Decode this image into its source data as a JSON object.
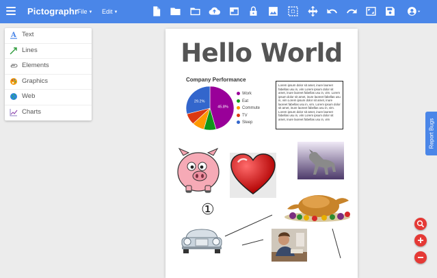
{
  "app": {
    "title": "Pictographr",
    "menus": [
      {
        "label": "File"
      },
      {
        "label": "Edit"
      }
    ],
    "toolbar_icons": [
      "new-document-icon",
      "folder-icon",
      "folder-open-icon",
      "cloud-upload-icon",
      "window-icon",
      "lock-icon",
      "image-icon",
      "select-area-icon",
      "move-icon",
      "undo-icon",
      "redo-icon",
      "fit-screen-icon",
      "save-icon",
      "account-icon"
    ],
    "accent_color": "#4a86e8"
  },
  "sidebar": {
    "items": [
      {
        "label": "Text",
        "icon": "text-icon"
      },
      {
        "label": "Lines",
        "icon": "line-icon"
      },
      {
        "label": "Elements",
        "icon": "paperclip-icon"
      },
      {
        "label": "Graphics",
        "icon": "palette-icon"
      },
      {
        "label": "Web",
        "icon": "globe-icon"
      },
      {
        "label": "Charts",
        "icon": "chart-icon"
      }
    ]
  },
  "canvas": {
    "heading": "Hello World",
    "lorem": "Lorem ipsum dolor sit amet, inure laoreet fabellas usu in, vim Lorem ipsum dolor sit amet, inure laoreet fabellas usu in, vim. Lorem ipsum dolor sit amet, inure laoreet fabellas usu in, vim Lorem ipsum dolor sit amet, inure laoreet fabellas usu in, vim. Lorem ipsum dolor sit amet, inure laoreet fabellas usu in, vim. Lorem ipsum dolor sit amet, inure laoreet fabellas usu in, vim Lorem ipsum dolor sit amet, inure laoreet fabellas usu in, vim",
    "number_badge": "①",
    "graphics": [
      "pig-clipart",
      "heart-clipart",
      "dog-photo",
      "turkey-clipart",
      "car-clipart",
      "person-photo"
    ]
  },
  "chart_data": {
    "type": "pie",
    "title": "Company Performance",
    "categories": [
      "Work",
      "Eat",
      "Commute",
      "TV",
      "Sleep"
    ],
    "values": [
      45.8,
      8.3,
      8.3,
      8.3,
      29.2
    ],
    "data_labels": [
      "45.8%",
      "",
      "",
      "",
      "29.2%"
    ],
    "colors": [
      "#990099",
      "#109618",
      "#ff9900",
      "#dc3912",
      "#3366cc"
    ],
    "legend": "right"
  },
  "report_bugs": {
    "label": "Report Bugs"
  },
  "fabs": [
    {
      "icon": "zoom-icon"
    },
    {
      "icon": "plus-icon"
    },
    {
      "icon": "minus-icon"
    }
  ]
}
